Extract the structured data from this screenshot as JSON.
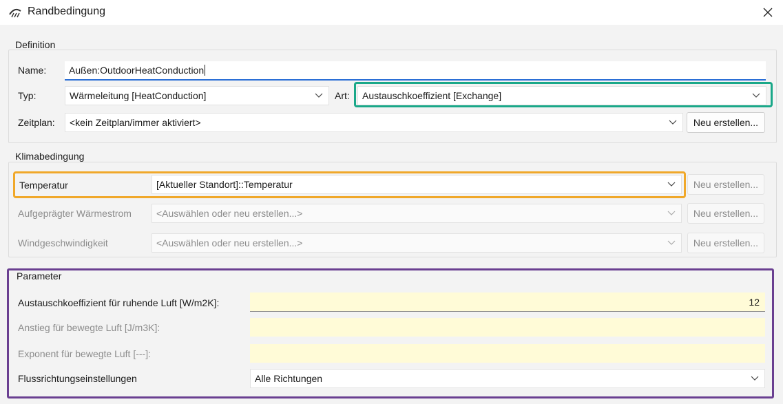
{
  "window": {
    "title": "Randbedingung"
  },
  "colors": {
    "accent": "#2b6fd6",
    "highlight_teal": "#1aa889",
    "highlight_orange": "#f0a82a",
    "highlight_purple": "#6a3f91",
    "parameter_field": "#fffbd7"
  },
  "definition": {
    "title": "Definition",
    "name_label": "Name:",
    "name_value": "Außen:OutdoorHeatConduction",
    "typ_label": "Typ:",
    "typ_value": "Wärmeleitung [HeatConduction]",
    "art_label": "Art:",
    "art_value": "Austauschkoeffizient [Exchange]",
    "zeitplan_label": "Zeitplan:",
    "zeitplan_value": "<kein Zeitplan/immer aktiviert>",
    "new_button": "Neu erstellen..."
  },
  "klima": {
    "title": "Klimabedingung",
    "rows": [
      {
        "label": "Temperatur",
        "value": "[Aktueller Standort]::Temperatur",
        "button": "Neu erstellen..."
      },
      {
        "label": "Aufgeprägter Wärmestrom",
        "value": "<Auswählen oder neu erstellen...>",
        "button": "Neu erstellen..."
      },
      {
        "label": "Windgeschwindigkeit",
        "value": "<Auswählen oder neu erstellen...>",
        "button": "Neu erstellen..."
      }
    ]
  },
  "parameter": {
    "title": "Parameter",
    "rows": [
      {
        "label": "Austauschkoeffizient für ruhende Luft [W/m2K]:",
        "value": "12"
      },
      {
        "label": "Anstieg für bewegte Luft [J/m3K]:",
        "value": ""
      },
      {
        "label": "Exponent für bewegte Luft [---]:",
        "value": ""
      }
    ],
    "flow_label": "Flussrichtungseinstellungen",
    "flow_value": "Alle Richtungen"
  },
  "icons": {
    "app": "boundary-condition-icon",
    "close": "close-icon",
    "dropdown": "chevron-down-icon"
  }
}
